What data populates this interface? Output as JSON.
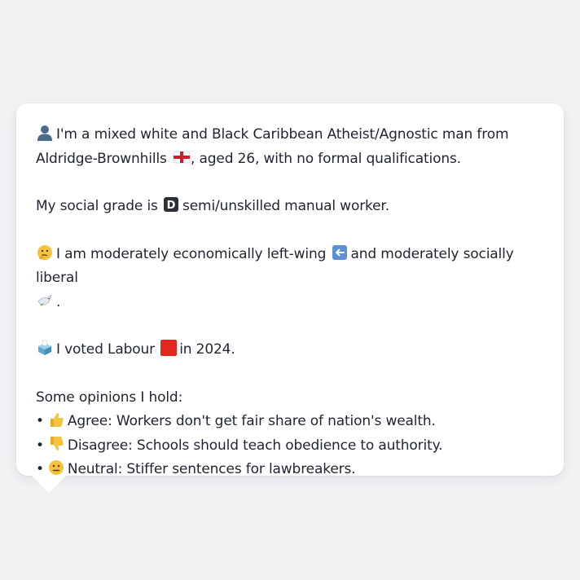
{
  "message": {
    "line1_text": "I'm a mixed white and Black Caribbean Atheist/Agnostic man from",
    "line2_a": "Aldridge-Brownhills",
    "line2_b": ", aged 26, with no formal qualifications.",
    "grade_a": "My social grade is",
    "grade_b": "semi/unskilled manual worker.",
    "econ_a": "I am moderately economically left-wing",
    "econ_b": "and moderately socially liberal",
    "econ_end": ".",
    "vote_a": "I voted Labour",
    "vote_b": "in 2024.",
    "opinions_header": "Some opinions I hold:",
    "opinions": [
      {
        "bullet": "•",
        "text": "Agree: Workers don't get fair share of nation's wealth.",
        "icon": "thumbs-up-icon"
      },
      {
        "bullet": "•",
        "text": "Disagree: Schools should teach obedience to authority.",
        "icon": "thumbs-down-icon"
      },
      {
        "bullet": "•",
        "text": "Neutral: Stiffer sentences for lawbreakers.",
        "icon": "neutral-face-icon"
      }
    ]
  },
  "icons": {
    "person": "person-silhouette-icon",
    "flag": "england-flag-icon",
    "grade": "letter-d-icon",
    "thinking": "thinking-face-icon",
    "left_arrow": "left-arrow-icon",
    "dove": "dove-icon",
    "ballot": "ballot-box-icon",
    "party": "red-square-icon"
  },
  "colors": {
    "background": "#f1f2f4",
    "bubble": "#ffffff",
    "text": "#1f2430",
    "labour_red": "#e0281f"
  }
}
